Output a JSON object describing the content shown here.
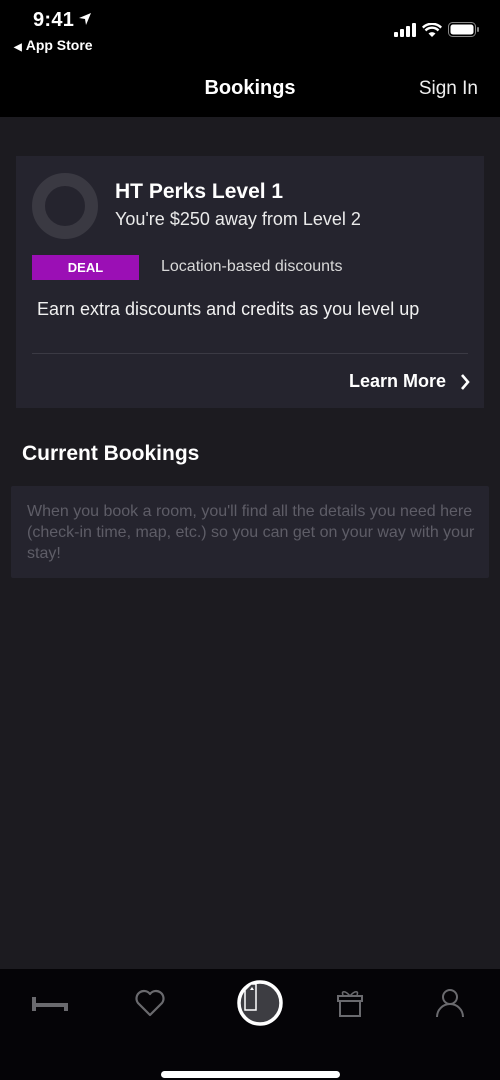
{
  "status_bar": {
    "time": "9:41",
    "back_label": "App Store",
    "icons": [
      "location-arrow-icon",
      "signal-icon",
      "wifi-icon",
      "battery-icon"
    ]
  },
  "navbar": {
    "title": "Bookings",
    "sign_in_label": "Sign In"
  },
  "perks": {
    "title": "HT Perks Level 1",
    "subtitle": "You're $250 away from Level 2",
    "deal_badge": "DEAL",
    "deal_text": "Location-based discounts",
    "description": "Earn extra discounts and credits as you level up",
    "learn_more_label": "Learn More",
    "badge_color": "#9b0fb5"
  },
  "current_bookings": {
    "title": "Current Bookings",
    "empty_message": "When you book a room, you'll find all the details you need here (check-in time, map, etc.) so you can get on your way with your stay!"
  },
  "tab_bar": {
    "tabs": [
      {
        "icon": "bed-icon",
        "active": false
      },
      {
        "icon": "heart-icon",
        "active": false
      },
      {
        "icon": "bookings-icon",
        "active": true
      },
      {
        "icon": "gift-icon",
        "active": false
      },
      {
        "icon": "profile-icon",
        "active": false
      }
    ]
  }
}
